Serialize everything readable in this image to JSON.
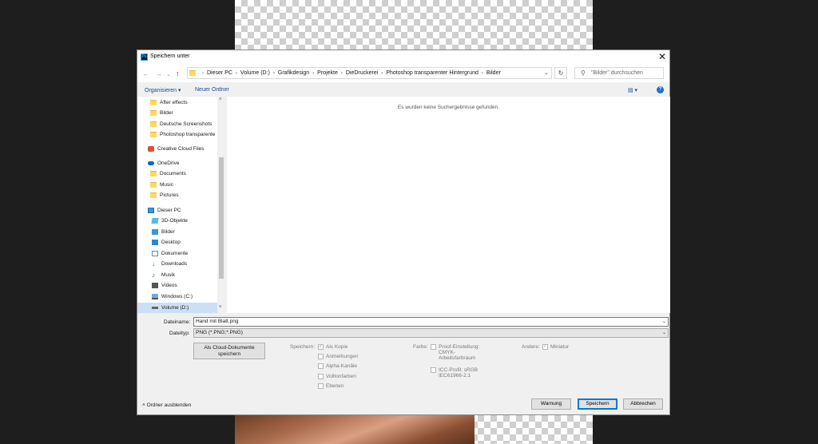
{
  "window": {
    "title": "Speichern unter",
    "app_icon": "Ps",
    "close": "✕"
  },
  "breadcrumb": [
    "Dieser PC",
    "Volume (D:)",
    "Grafikdesign",
    "Projekte",
    "DieDruckerei",
    "Photoshop transparenter Hintergrund",
    "Bilder"
  ],
  "search": {
    "placeholder": "\"Bilder\" durchsuchen"
  },
  "toolbar": {
    "organize": "Organisieren ▾",
    "new_folder": "Neuer Ordner"
  },
  "nav_pane": {
    "items": [
      {
        "label": "After effects",
        "icon": "folder-icon"
      },
      {
        "label": "Bilder",
        "icon": "folder-icon"
      },
      {
        "label": "Deutsche Screenshots",
        "icon": "folder-icon"
      },
      {
        "label": "Photoshop transparente",
        "icon": "folder-icon"
      },
      {
        "label": "Creative Cloud Files",
        "icon": "creative-cloud-icon"
      },
      {
        "label": "OneDrive",
        "icon": "cloud-icon"
      },
      {
        "label": "Documents",
        "icon": "folder-icon"
      },
      {
        "label": "Music",
        "icon": "folder-icon"
      },
      {
        "label": "Pictures",
        "icon": "folder-icon"
      },
      {
        "label": "Dieser PC",
        "icon": "pc-icon"
      },
      {
        "label": "3D-Objekte",
        "icon": "3d-objects-icon"
      },
      {
        "label": "Bilder",
        "icon": "pictures-icon"
      },
      {
        "label": "Desktop",
        "icon": "desktop-icon"
      },
      {
        "label": "Dokumente",
        "icon": "documents-icon"
      },
      {
        "label": "Downloads",
        "icon": "download-icon"
      },
      {
        "label": "Musik",
        "icon": "music-icon"
      },
      {
        "label": "Videos",
        "icon": "videos-icon"
      },
      {
        "label": "Windows (C:)",
        "icon": "drive-icon"
      },
      {
        "label": "Volume (D:)",
        "icon": "drive-icon"
      }
    ]
  },
  "content": {
    "empty_message": "Es wurden keine Suchergebnisse gefunden."
  },
  "filename": {
    "label": "Dateiname:",
    "value": "Hand mit Blatt.png"
  },
  "filetype": {
    "label": "Dateityp:",
    "value": "PNG (*.PNG;*.PNG)"
  },
  "cloud_button": {
    "line1": "Als Cloud-Dokumente",
    "line2": "speichern"
  },
  "options": {
    "save_label": "Speichern:",
    "save": [
      {
        "label": "Als Kopie",
        "checked": true
      },
      {
        "label": "Anmerkungen",
        "checked": false
      },
      {
        "label": "Alpha-Kanäle",
        "checked": false
      },
      {
        "label": "Volltonfarben",
        "checked": false
      },
      {
        "label": "Ebenen",
        "checked": false
      }
    ],
    "color_label": "Farbe:",
    "proof": {
      "line1": "Proof-Einstellung:",
      "line2": "CMYK-",
      "line3": "Arbeitsfarbraum",
      "checked": false
    },
    "icc": {
      "line1": "ICC-Profil: sRGB",
      "line2": "IEC61966-2.1",
      "checked": false
    },
    "other_label": "Andere:",
    "thumbnail": {
      "label": "Miniatur",
      "checked": true
    }
  },
  "buttons": {
    "warning": "Warnung",
    "save": "Speichern",
    "cancel": "Abbrechen"
  },
  "hide_folders": "Ordner ausblenden",
  "colors": {
    "accent": "#0078d7",
    "folder": "#ffd764",
    "link": "#1a4b8c"
  }
}
